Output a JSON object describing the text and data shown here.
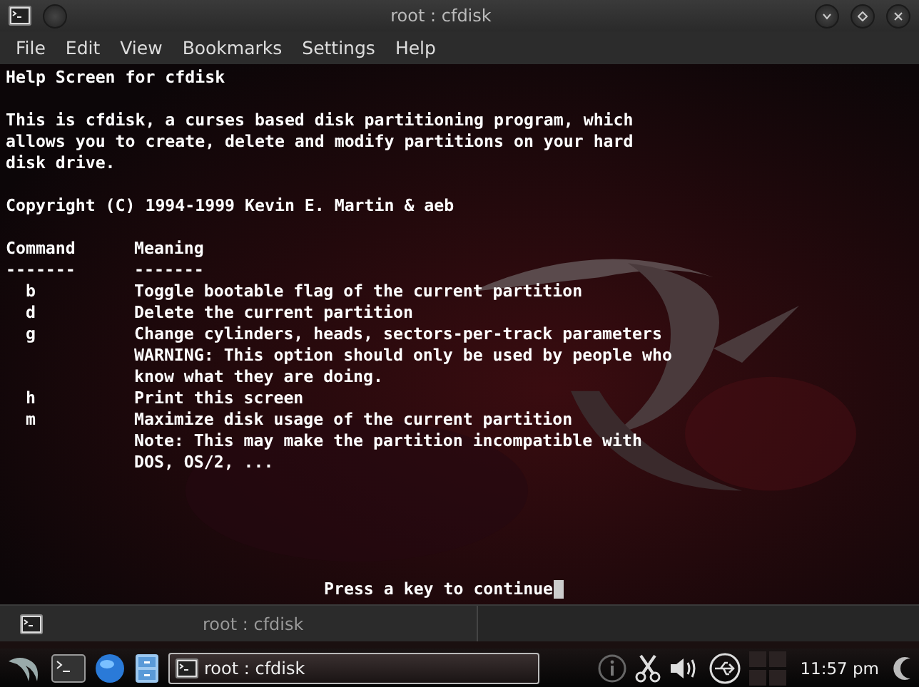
{
  "window": {
    "title": "root : cfdisk"
  },
  "menu": [
    {
      "label": "File"
    },
    {
      "label": "Edit"
    },
    {
      "label": "View"
    },
    {
      "label": "Bookmarks"
    },
    {
      "label": "Settings"
    },
    {
      "label": "Help"
    }
  ],
  "terminal": {
    "heading": "Help Screen for cfdisk",
    "intro": [
      "This is cfdisk, a curses based disk partitioning program, which",
      "allows you to create, delete and modify partitions on your hard",
      "disk drive."
    ],
    "copyright": "Copyright (C) 1994-1999 Kevin E. Martin & aeb",
    "columns": [
      {
        "title": "Command",
        "rule": "-------"
      },
      {
        "title": "Meaning",
        "rule": "-------"
      }
    ],
    "commands": [
      {
        "key": "b",
        "lines": [
          "Toggle bootable flag of the current partition"
        ]
      },
      {
        "key": "d",
        "lines": [
          "Delete the current partition"
        ]
      },
      {
        "key": "g",
        "lines": [
          "Change cylinders, heads, sectors-per-track parameters",
          "WARNING: This option should only be used by people who",
          "know what they are doing."
        ]
      },
      {
        "key": "h",
        "lines": [
          "Print this screen"
        ]
      },
      {
        "key": "m",
        "lines": [
          "Maximize disk usage of the current partition",
          "Note: This may make the partition incompatible with",
          "DOS, OS/2, ..."
        ]
      }
    ],
    "prompt": "Press a key to continue"
  },
  "tabs": [
    {
      "label": "root : cfdisk",
      "selected": true
    }
  ],
  "taskbar": {
    "tasks": [
      {
        "label": "root : cfdisk",
        "selected": true
      }
    ],
    "clock": "11:57 pm"
  }
}
